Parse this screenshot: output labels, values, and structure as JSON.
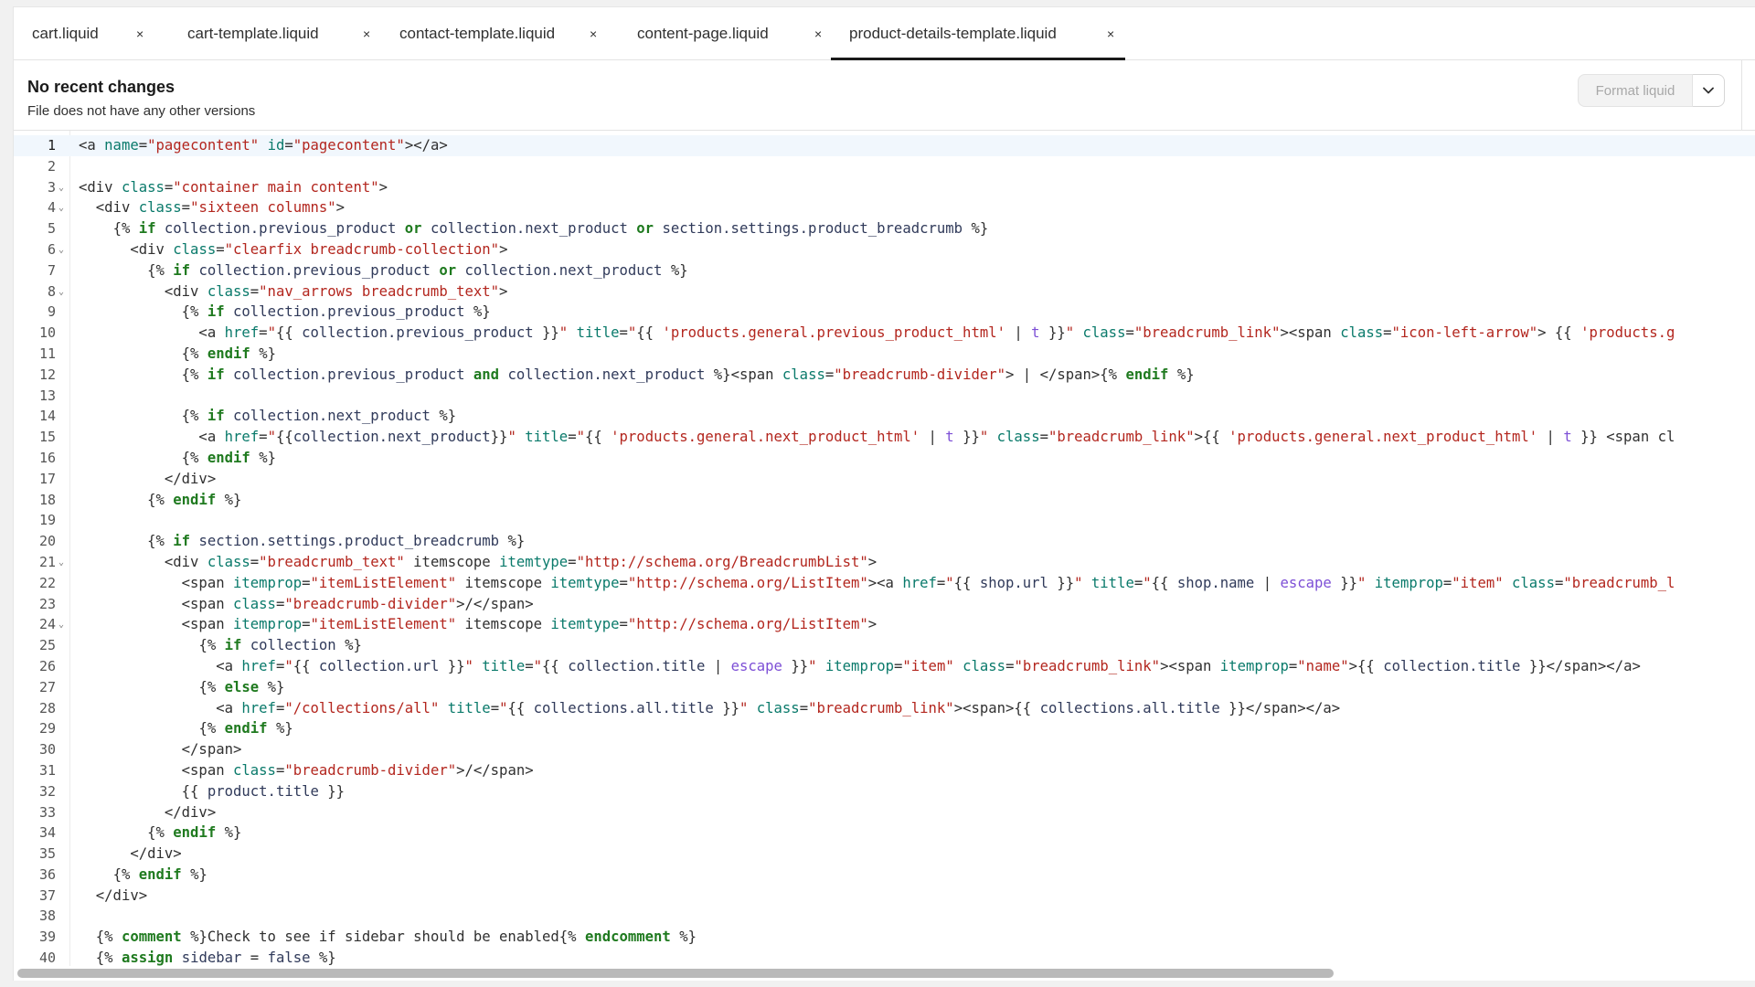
{
  "tabs": [
    {
      "label": "cart.liquid",
      "close": "×",
      "active": false
    },
    {
      "label": "cart-template.liquid",
      "close": "×",
      "active": false
    },
    {
      "label": "contact-template.liquid",
      "close": "×",
      "active": false
    },
    {
      "label": "content-page.liquid",
      "close": "×",
      "active": false
    },
    {
      "label": "product-details-template.liquid",
      "close": "×",
      "active": true
    }
  ],
  "version": {
    "title": "No recent changes",
    "subtitle": "File does not have any other versions",
    "format_label": "Format liquid",
    "dropdown_icon": "chevron-down-icon"
  },
  "editor": {
    "active_line": 1,
    "foldable_lines": [
      3,
      4,
      6,
      8,
      21,
      24
    ],
    "lines": [
      "<a name=\"pagecontent\" id=\"pagecontent\"></a>",
      "",
      "<div class=\"container main content\">",
      "  <div class=\"sixteen columns\">",
      "    {% if collection.previous_product or collection.next_product or section.settings.product_breadcrumb %}",
      "      <div class=\"clearfix breadcrumb-collection\">",
      "        {% if collection.previous_product or collection.next_product %}",
      "          <div class=\"nav_arrows breadcrumb_text\">",
      "            {% if collection.previous_product %}",
      "              <a href=\"{{ collection.previous_product }}\" title=\"{{ 'products.general.previous_product_html' | t }}\" class=\"breadcrumb_link\"><span class=\"icon-left-arrow\"> {{ 'products.g",
      "            {% endif %}",
      "            {% if collection.previous_product and collection.next_product %}<span class=\"breadcrumb-divider\"> | </span>{% endif %}",
      "",
      "            {% if collection.next_product %}",
      "              <a href=\"{{collection.next_product}}\" title=\"{{ 'products.general.next_product_html' | t }}\" class=\"breadcrumb_link\">{{ 'products.general.next_product_html' | t }} <span cl",
      "            {% endif %}",
      "          </div>",
      "        {% endif %}",
      "",
      "        {% if section.settings.product_breadcrumb %}",
      "          <div class=\"breadcrumb_text\" itemscope itemtype=\"http://schema.org/BreadcrumbList\">",
      "            <span itemprop=\"itemListElement\" itemscope itemtype=\"http://schema.org/ListItem\"><a href=\"{{ shop.url }}\" title=\"{{ shop.name | escape }}\" itemprop=\"item\" class=\"breadcrumb_l",
      "            <span class=\"breadcrumb-divider\">/</span>",
      "            <span itemprop=\"itemListElement\" itemscope itemtype=\"http://schema.org/ListItem\">",
      "              {% if collection %}",
      "                <a href=\"{{ collection.url }}\" title=\"{{ collection.title | escape }}\" itemprop=\"item\" class=\"breadcrumb_link\"><span itemprop=\"name\">{{ collection.title }}</span></a>",
      "              {% else %}",
      "                <a href=\"/collections/all\" title=\"{{ collections.all.title }}\" class=\"breadcrumb_link\"><span>{{ collections.all.title }}</span></a>",
      "              {% endif %}",
      "            </span>",
      "            <span class=\"breadcrumb-divider\">/</span>",
      "            {{ product.title }}",
      "          </div>",
      "        {% endif %}",
      "      </div>",
      "    {% endif %}",
      "  </div>",
      "",
      "  {% comment %}Check to see if sidebar should be enabled{% endcomment %}",
      "  {% assign sidebar = false %}"
    ]
  }
}
